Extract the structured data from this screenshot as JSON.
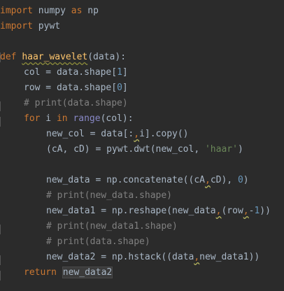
{
  "code": {
    "l1": {
      "kw1": "import",
      "rest": " numpy ",
      "kw2": "as",
      "rest2": " np"
    },
    "l2": {
      "kw": "import",
      "rest": " pywt"
    },
    "l3": {
      "kw": "def",
      "space": " ",
      "fn": "haar_wavelet",
      "rest": "(data):"
    },
    "l4": {
      "a": "col = data.shape[",
      "n": "1",
      "b": "]"
    },
    "l5": {
      "a": "row = data.shape[",
      "n": "0",
      "b": "]"
    },
    "l6": {
      "c": "# print(data.shape)"
    },
    "l7": {
      "kw": "for",
      "a": " i ",
      "kw2": "in",
      "sp": " ",
      "b": "range",
      "c": "(col):"
    },
    "l8": {
      "a": "new_col = data[:",
      "sep": ",",
      "b": "i].copy()"
    },
    "l9": {
      "a": "(cA, cD) = pywt.dwt(new_col, ",
      "s": "'haar'",
      "b": ")"
    },
    "l10": {
      "a": "new_data = np.concatenate((cA",
      "sep": ",",
      "b": "cD), ",
      "n": "0",
      "c": ")"
    },
    "l11": {
      "c": "# print(new_data.shape)"
    },
    "l12": {
      "a": "new_data1 = np.reshape(new_data",
      "sep": ",",
      "b": "(row",
      "sep2": ",",
      "c": "-",
      "n": "1",
      "d": "))"
    },
    "l13": {
      "c": "# print(new_data1.shape)"
    },
    "l14": {
      "c": "# print(data.shape)"
    },
    "l15": {
      "a": "new_data2 = np.hstack((data",
      "sep": ",",
      "b": "new_data1))"
    },
    "l16": {
      "kw": "return",
      "sp": " ",
      "hl": "new_data2"
    }
  }
}
